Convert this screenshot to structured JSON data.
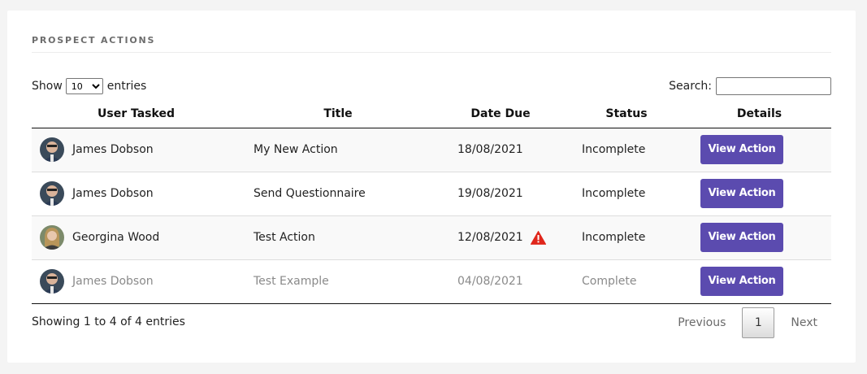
{
  "panel": {
    "title": "PROSPECT ACTIONS"
  },
  "controls": {
    "show_label": "Show",
    "entries_label": "entries",
    "page_length": "10",
    "search_label": "Search:",
    "search_value": ""
  },
  "table": {
    "headers": [
      "User Tasked",
      "Title",
      "Date Due",
      "Status",
      "Details"
    ],
    "rows": [
      {
        "user": "James Dobson",
        "avatar": "male-portrait-avatar",
        "title": "My New Action",
        "date": "18/08/2021",
        "overdue": false,
        "status": "Incomplete",
        "button": "View Action",
        "muted": false
      },
      {
        "user": "James Dobson",
        "avatar": "male-portrait-avatar",
        "title": "Send Questionnaire",
        "date": "19/08/2021",
        "overdue": false,
        "status": "Incomplete",
        "button": "View Action",
        "muted": false
      },
      {
        "user": "Georgina Wood",
        "avatar": "female-portrait-avatar",
        "title": "Test Action",
        "date": "12/08/2021",
        "overdue": true,
        "status": "Incomplete",
        "button": "View Action",
        "muted": false
      },
      {
        "user": "James Dobson",
        "avatar": "male-portrait-avatar",
        "title": "Test Example",
        "date": "04/08/2021",
        "overdue": false,
        "status": "Complete",
        "button": "View Action",
        "muted": true
      }
    ]
  },
  "footer": {
    "info": "Showing 1 to 4 of 4 entries",
    "previous": "Previous",
    "current_page": "1",
    "next": "Next"
  },
  "colors": {
    "button": "#5b4baf",
    "warning": "#e0261b",
    "muted_text": "#8a8a8a"
  }
}
